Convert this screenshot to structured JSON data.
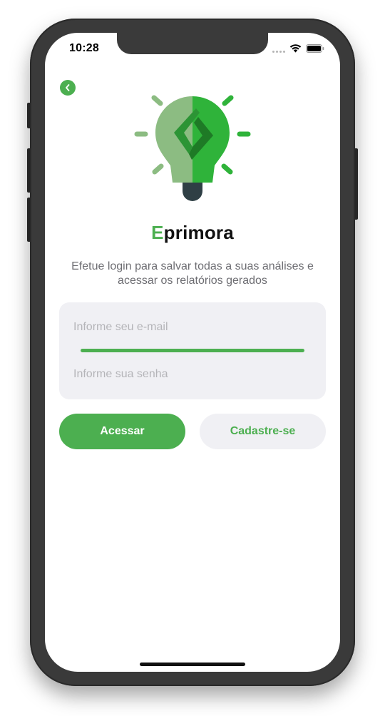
{
  "status_bar": {
    "time": "10:28",
    "icons": [
      "signal-icon",
      "wifi-icon",
      "battery-icon"
    ]
  },
  "back_button": {
    "icon": "chevron-left-icon"
  },
  "logo": {
    "icon": "lightbulb-bolt-icon"
  },
  "brand": {
    "first_letter": "E",
    "rest": "primora"
  },
  "subtitle": "Efetue login para salvar todas a suas análises e acessar os relatórios gerados",
  "form": {
    "email_placeholder": "Informe seu e-mail",
    "email_value": "",
    "password_placeholder": "Informe sua senha",
    "password_value": ""
  },
  "actions": {
    "login_label": "Acessar",
    "signup_label": "Cadastre-se"
  },
  "colors": {
    "accent": "#4caf50",
    "field_background": "#f0f0f4",
    "subtitle_text": "#6d6d72",
    "placeholder_text": "#b4b4b8",
    "bulb_light": "#8cbc82",
    "bulb_bright": "#2fb33a",
    "bolt_dark": "#1e7a26",
    "bulb_base": "#2f3f45"
  }
}
